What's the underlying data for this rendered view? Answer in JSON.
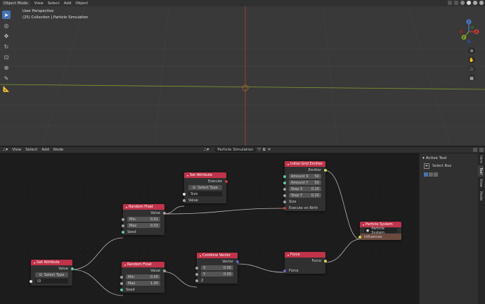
{
  "viewport_header": {
    "mode": "Object Mode",
    "menus": [
      "View",
      "Select",
      "Add",
      "Object"
    ]
  },
  "viewport": {
    "perspective": "User Perspective",
    "collection": "(25) Collection | Particle Simulation",
    "gizmo_axes": [
      "X",
      "Y",
      "Z"
    ],
    "tools": [
      "select-box",
      "cursor",
      "move",
      "rotate",
      "scale",
      "transform",
      "annotate",
      "measure"
    ]
  },
  "node_header": {
    "menus": [
      "View",
      "Select",
      "Add",
      "Node"
    ],
    "tree_name": "Particle Simulation"
  },
  "nodes": {
    "get_attribute": {
      "title": "Get Attribute",
      "output": "Value",
      "select": "Select Type",
      "input": "ID"
    },
    "random_float_1": {
      "title": "Random Float",
      "output": "Value",
      "min_label": "Min",
      "min_value": "0.01",
      "max_label": "Max",
      "max_value": "0.03",
      "seed": "Seed"
    },
    "random_float_2": {
      "title": "Random Float",
      "output": "Value",
      "min_label": "Min",
      "min_value": "0.00",
      "max_label": "Max",
      "max_value": "1.00",
      "seed": "Seed"
    },
    "set_attribute": {
      "title": "Set Attribute",
      "output": "Execute",
      "select": "Select Type",
      "size": "Size",
      "value": "Value"
    },
    "combine_vector": {
      "title": "Combine Vector",
      "output": "Vector",
      "x_label": "X",
      "x_value": "0.00",
      "y_label": "Y",
      "y_value": "0.00",
      "z_label": "Z"
    },
    "grid_emitter": {
      "title": "Initial Grid Emitter",
      "output": "Emitter",
      "amount_x_label": "Amount X",
      "amount_x_value": "50",
      "amount_y_label": "Amount Y",
      "amount_y_value": "50",
      "step_x_label": "Step X",
      "step_x_value": "0.20",
      "step_y_label": "Step Y",
      "step_y_value": "0.20",
      "size": "Size",
      "execute": "Execute on Birth"
    },
    "force": {
      "title": "Force",
      "output": "Force",
      "input": "Force"
    },
    "particle_system": {
      "title": "Particle System",
      "field": "Particle System",
      "input": "Influences"
    }
  },
  "sidebar": {
    "panel_title": "Active Tool",
    "tool_name": "Select Box",
    "tabs": [
      "Item",
      "Tool",
      "View",
      "Node"
    ]
  },
  "colors": {
    "node_header": "#c0334a",
    "socket_value": "#a1a1a1",
    "socket_vector": "#6363c7",
    "socket_control": "#63c7a4",
    "grid_x_axis": "#b33a3a",
    "grid_y_axis": "#7c9a2e",
    "active_tool": "#4772b3"
  }
}
